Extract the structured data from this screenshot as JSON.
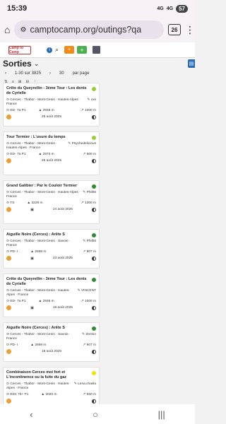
{
  "status": {
    "time": "15:39",
    "signal1": "4G",
    "signal2": "4G",
    "battery": "57"
  },
  "browser": {
    "url": "camptocamp.org/outings?qa",
    "tab_count": "26"
  },
  "site": {
    "logo": "Camp to Camp"
  },
  "page": {
    "title": "Sorties",
    "title_arrow": "⌄"
  },
  "pager": {
    "range": "1-30 sur 3825",
    "per_page_value": "30",
    "per_page_label": "par page"
  },
  "tools": {
    "sort_label": "⇅",
    "view1": "≡",
    "view2": "⊞",
    "view3": "⊟",
    "view4": "⋮"
  },
  "cards": [
    {
      "title": "Crête du Queyrellin - 3ème Tour : Les dents de Cyrielle",
      "dot_color": "#9acd32",
      "area": "Cerces - Thabor - Mont-Cenis · Hautes-Alpes · France",
      "author": "",
      "author_extra": "xxx",
      "grade": "ED- 7a P1",
      "elevation": "2936 m",
      "gain": "1000 m",
      "date": "25 août 2025",
      "has_camera": false
    },
    {
      "title": "Tour Termier : L'usure du temps",
      "dot_color": "#9acd32",
      "area": "Cerces - Thabor - Mont-Cenis · Hautes-Alpes · France",
      "author": "Psychedelicious",
      "author_extra": "",
      "grade": "ED- 7a P1",
      "elevation": "2970 m",
      "gain": "500 m",
      "date": "25 août 2025",
      "has_camera": false
    },
    {
      "title": "Grand Galibier : Par le Couloir Termier",
      "dot_color": "#2e8b2e",
      "area": "Cerces - Thabor - Mont-Cenis · Hautes-Alpes · France",
      "author": "Phil06",
      "author_extra": "",
      "grade": "TS",
      "elevation": "3228 m",
      "gain": "1300 m",
      "date": "24 août 2025",
      "has_camera": true
    },
    {
      "title": "Aiguille Noire (Cerces) : Arête S",
      "dot_color": "#2e8b2e",
      "area": "Cerces - Thabor - Mont-Cenis · Savoie · France",
      "author": "Phil06",
      "author_extra": "",
      "grade": "PD- I",
      "elevation": "2869 m",
      "gain": "907 m",
      "date": "23 août 2025",
      "has_camera": true
    },
    {
      "title": "Crête du Queyrellin - 3ème Tour : Les dents de Cyrielle",
      "dot_color": "#2e8b2e",
      "area": "Cerces - Thabor - Mont-Cenis · Hautes-Alpes · France",
      "author": "VINCENT",
      "author_extra": "",
      "grade": "ED- 7a P1",
      "elevation": "2936 m",
      "gain": "1000 m",
      "date": "18 août 2025",
      "has_camera": true
    },
    {
      "title": "Aiguille Noire (Cerces) : Arête S",
      "dot_color": "#2e8b2e",
      "area": "Cerces - Thabor - Mont-Cenis · Savoie · France",
      "author": "Zenlon",
      "author_extra": "",
      "grade": "PD- I",
      "elevation": "2869 m",
      "gain": "907 m",
      "date": "18 août 2025",
      "has_camera": false
    },
    {
      "title": "Combinaison Cerces moi fort et L'incontinence ou la fuite du gaz",
      "dot_color": "#f0e500",
      "area": "Cerces - Thabor - Mont-Cenis · Hautes-Alpes · France",
      "author": "Lena.chasla",
      "author_extra": "",
      "grade": "ED4 7b+ P1",
      "elevation": "3020 m",
      "gain": "550 m",
      "date": "",
      "has_camera": false
    }
  ],
  "nav": {
    "back": "‹",
    "home": "○",
    "recents": "|||"
  }
}
